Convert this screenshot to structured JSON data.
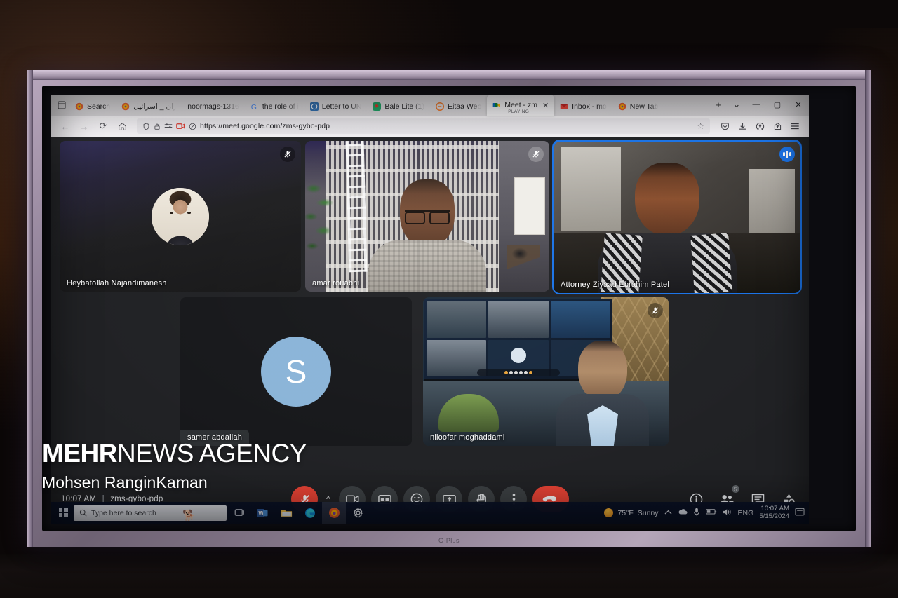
{
  "scene": {
    "device_brand": "G-Plus"
  },
  "browser": {
    "tablist_icon": "tab-list-icon",
    "tabs": [
      {
        "label": "Search",
        "favicon": "firefox-icon",
        "active": false
      },
      {
        "label": "ایران _ اسرائیل",
        "favicon": "firefox-icon",
        "active": false
      },
      {
        "label": "noormags-1316",
        "favicon": "page-icon",
        "active": false
      },
      {
        "label": "the role of i",
        "favicon": "google-icon",
        "active": false
      },
      {
        "label": "Letter to UN",
        "favicon": "un-icon",
        "active": false
      },
      {
        "label": "Bale Lite (1)",
        "favicon": "bale-icon",
        "active": false
      },
      {
        "label": "Eitaa Web",
        "favicon": "eitaa-icon",
        "active": false
      },
      {
        "label": "Meet - zm",
        "sublabel": "PLAYING",
        "favicon": "meet-icon",
        "active": true
      },
      {
        "label": "Inbox - mo",
        "favicon": "gmail-icon",
        "active": false
      },
      {
        "label": "New Tab",
        "favicon": "firefox-icon",
        "active": false
      }
    ],
    "new_tab_label": "+",
    "list_all_tabs_label": "⌄",
    "window_controls": {
      "minimize": "—",
      "maximize": "▢",
      "close": "✕"
    },
    "nav": {
      "back": "←",
      "forward": "→",
      "reload": "⟳",
      "home": "⌂"
    },
    "url": "https://meet.google.com/zms-gybo-pdp",
    "url_icons": [
      "shield-icon",
      "lock-icon",
      "permissions-icon",
      "camera-blocked-icon",
      "autoplay-blocked-icon"
    ],
    "bookmark_label": "☆",
    "toolbar_right_icons": [
      "pocket-icon",
      "downloads-icon",
      "account-icon",
      "sync-icon",
      "menu-icon"
    ]
  },
  "meet": {
    "info_time": "10:07 AM",
    "info_separator": "|",
    "info_code": "zms-gybo-pdp",
    "tiles": [
      {
        "name": "Heybatollah Najandimanesh",
        "muted": true,
        "speaking": false,
        "avatar_type": "photo"
      },
      {
        "name": "amar rouabhi",
        "muted": true,
        "speaking": false,
        "avatar_type": "video"
      },
      {
        "name": "Attorney Ziyaad Ebrahim Patel",
        "muted": false,
        "speaking": true,
        "avatar_type": "video"
      },
      {
        "name": "samer abdallah",
        "muted": false,
        "speaking": false,
        "avatar_type": "letter",
        "avatar_letter": "S"
      },
      {
        "name": "niloofar moghaddami",
        "muted": true,
        "speaking": false,
        "avatar_type": "video"
      }
    ],
    "controls": [
      {
        "name": "microphone",
        "label": "mic-off-icon",
        "state": "muted"
      },
      {
        "name": "mic-options",
        "label": "chevron-up-icon"
      },
      {
        "name": "camera",
        "label": "camera-icon"
      },
      {
        "name": "captions",
        "label": "cc-icon"
      },
      {
        "name": "reactions",
        "label": "emoji-icon"
      },
      {
        "name": "present",
        "label": "present-screen-icon"
      },
      {
        "name": "raise-hand",
        "label": "hand-icon"
      },
      {
        "name": "more-options",
        "label": "more-vertical-icon"
      },
      {
        "name": "leave-call",
        "label": "end-call-icon"
      }
    ],
    "right_controls": [
      {
        "name": "meeting-details",
        "label": "info-icon"
      },
      {
        "name": "show-everyone",
        "label": "people-icon",
        "badge": "5"
      },
      {
        "name": "chat",
        "label": "chat-icon"
      },
      {
        "name": "activities",
        "label": "activities-icon"
      }
    ]
  },
  "taskbar": {
    "start_label": "windows-start-icon",
    "search_placeholder": "Type here to search",
    "search_icon": "search-icon",
    "pinned": [
      {
        "name": "task-view",
        "label": "task-view-icon"
      },
      {
        "name": "word",
        "label": "word-icon"
      },
      {
        "name": "file-explorer",
        "label": "folder-icon"
      },
      {
        "name": "edge",
        "label": "edge-icon"
      },
      {
        "name": "firefox",
        "label": "firefox-icon",
        "active": true
      },
      {
        "name": "settings",
        "label": "gear-icon"
      }
    ],
    "weather_temp": "75°F",
    "weather_desc": "Sunny",
    "tray_icons": [
      "chevron-up-icon",
      "onedrive-icon",
      "microphone-icon",
      "battery-icon",
      "volume-icon"
    ],
    "language": "ENG",
    "clock_time": "10:07 AM",
    "clock_date": "5/15/2024",
    "notification_icon": "notifications-icon"
  },
  "watermark": {
    "brand_bold": "MEHR",
    "brand_rest": "NEWS AGENCY",
    "photographer": "Mohsen RanginKaman"
  }
}
